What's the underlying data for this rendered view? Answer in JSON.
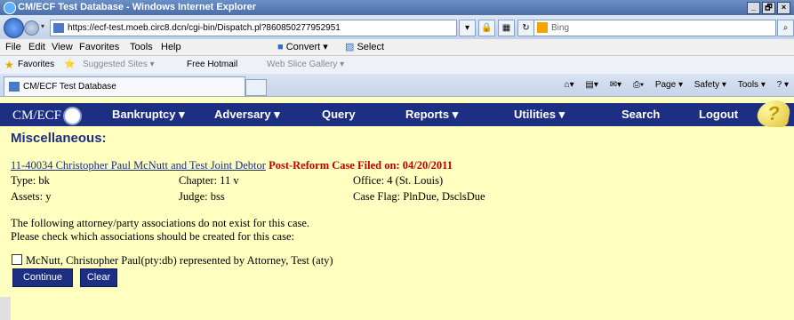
{
  "window": {
    "title": "CM/ECF Test Database - Windows Internet Explorer",
    "buttons": [
      "_",
      "🗗",
      "×"
    ]
  },
  "address_bar": {
    "url": "https://ecf-test.moeb.circ8.dcn/cgi-bin/Dispatch.pl?860850277952951",
    "search_placeholder": "Bing"
  },
  "menu_bar": {
    "items": [
      "File",
      "Edit",
      "View",
      "Favorites",
      "Tools",
      "Help"
    ],
    "convert": "Convert",
    "select": "Select"
  },
  "favorites_bar": {
    "favorites": "Favorites",
    "suggested": "Suggested Sites ▾",
    "hotmail": "Free Hotmail",
    "webslice": "Web Slice Gallery ▾"
  },
  "tab": {
    "title": "CM/ECF Test Database"
  },
  "command_bar": {
    "page": "Page ▾",
    "safety": "Safety ▾",
    "tools": "Tools ▾",
    "help": "? ▾"
  },
  "ecf_menu": {
    "logo": "CM/ECF",
    "items": [
      "Bankruptcy ▾",
      "Adversary ▾",
      "Query",
      "Reports ▾",
      "Utilities ▾",
      "Search",
      "Logout"
    ]
  },
  "page": {
    "title": "Miscellaneous:",
    "case_link": "11-40034 Christopher Paul McNutt and Test Joint Debtor",
    "case_status": " Post-Reform Case Filed on: 04/20/2011",
    "type": "Type: bk",
    "chapter": "Chapter: 11 v",
    "office": "Office: 4 (St. Louis)",
    "assets": "Assets: y",
    "judge": "Judge: bss",
    "case_flag": "Case Flag: PlnDue, DsclsDue",
    "msg_line1": "The following attorney/party associations do not exist for this case.",
    "msg_line2": "Please check which associations should be created for this case:",
    "association": "McNutt, Christopher Paul(pty:db) represented by Attorney, Test (aty)",
    "continue_btn": "Continue",
    "clear_btn": "Clear"
  }
}
